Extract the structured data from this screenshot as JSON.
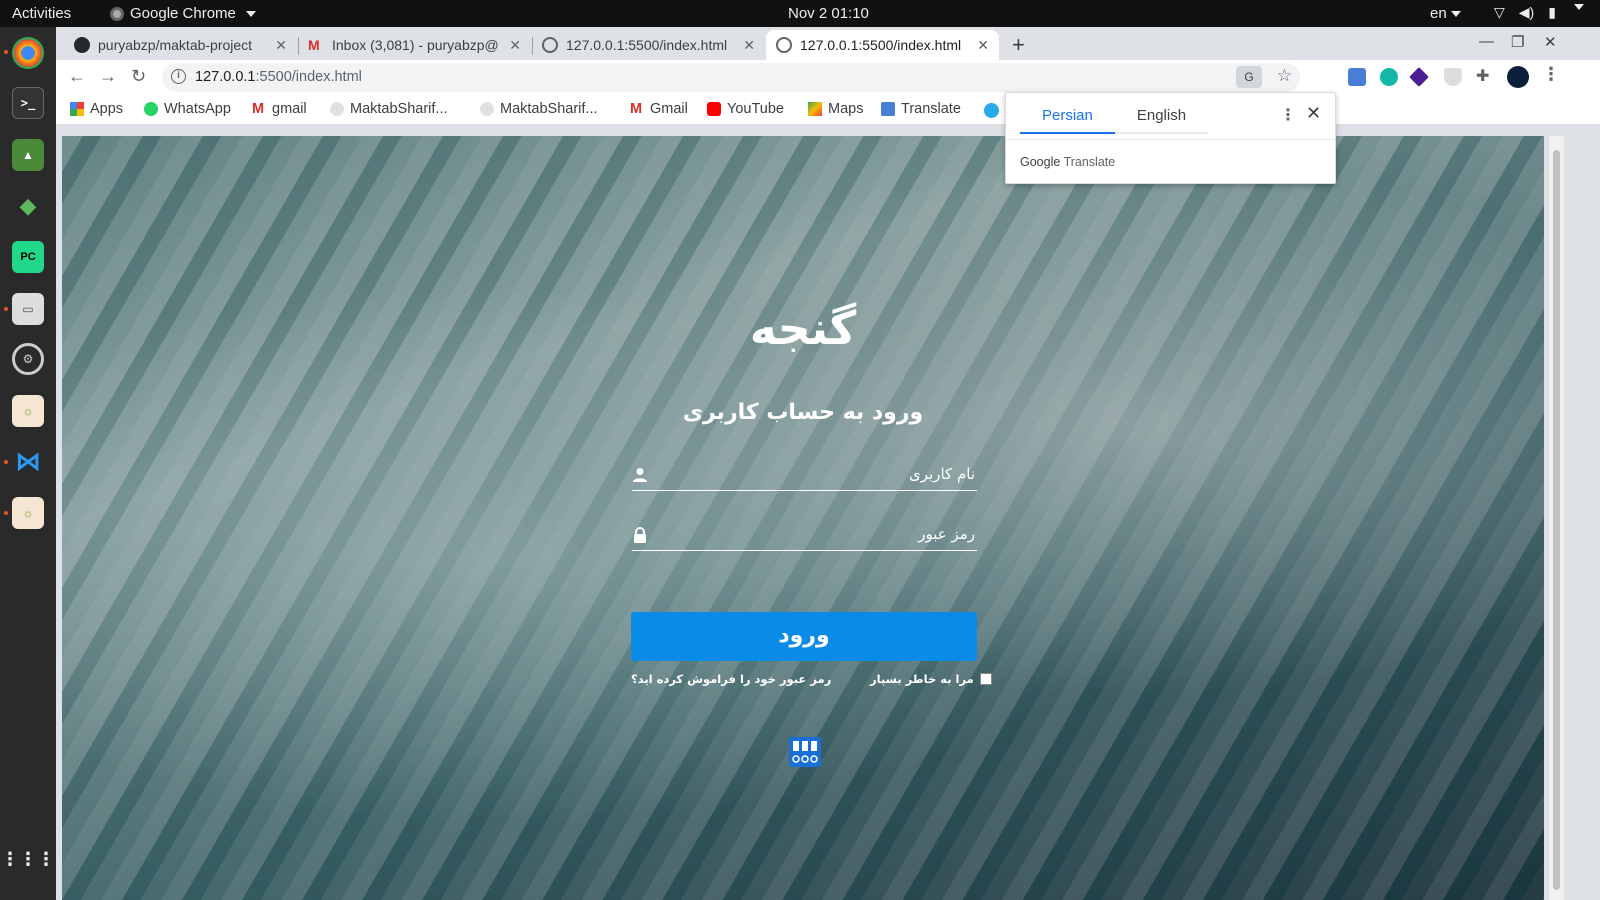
{
  "topbar": {
    "activities": "Activities",
    "app_name": "Google Chrome",
    "clock": "Nov 2  01:10",
    "language": "en"
  },
  "tabs": [
    {
      "title": "puryabzp/maktab-project",
      "icon": "github-icon"
    },
    {
      "title": "Inbox (3,081) - puryabzp@",
      "icon": "gmail-icon"
    },
    {
      "title": "127.0.0.1:5500/index.html",
      "icon": "globe-icon"
    },
    {
      "title": "127.0.0.1:5500/index.html",
      "icon": "globe-icon"
    }
  ],
  "omnibox": {
    "url_host": "127.0.0.1",
    "url_rest": ":5500/index.html"
  },
  "bookmarks": [
    {
      "label": "Apps",
      "icon": "apps-grid-icon"
    },
    {
      "label": "WhatsApp",
      "icon": "whatsapp-icon"
    },
    {
      "label": "gmail",
      "icon": "gmail-icon"
    },
    {
      "label": "MaktabSharif...",
      "icon": "maktab-icon"
    },
    {
      "label": "MaktabSharif...",
      "icon": "maktab-icon"
    },
    {
      "label": "Gmail",
      "icon": "gmail-icon"
    },
    {
      "label": "YouTube",
      "icon": "youtube-icon"
    },
    {
      "label": "Maps",
      "icon": "maps-icon"
    },
    {
      "label": "Translate",
      "icon": "translate-icon"
    }
  ],
  "translate_popup": {
    "source_lang": "Persian",
    "target_lang": "English",
    "footer_brand": "Google",
    "footer_product": "Translate"
  },
  "page": {
    "logo_text": "گنجه",
    "heading": "ورود به حساب کاربری",
    "username_placeholder": "نام کاربری",
    "password_placeholder": "رمز عبور",
    "login_button": "ورود",
    "remember_me": "مرا به خاطر بسپار",
    "forgot_password": "رمز عبور خود را فراموش کرده اید؟"
  },
  "colors": {
    "accent_button": "#0a8be8",
    "translate_active": "#1a73e8"
  }
}
